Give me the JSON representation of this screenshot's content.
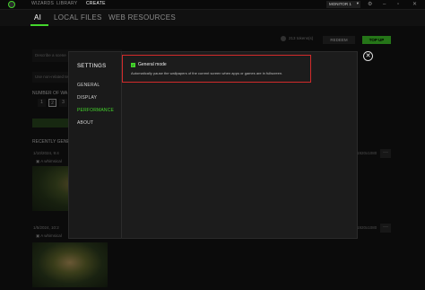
{
  "nav": {
    "items": [
      "WIZARDS",
      "LIBRARY",
      "CREATE"
    ],
    "active_index": 2
  },
  "monitor": {
    "label": "MONITOR 1"
  },
  "window_icons": [
    "gear-icon",
    "minimize-icon",
    "maximize-icon",
    "close-icon"
  ],
  "tabs": {
    "items": [
      "AI",
      "LOCAL FILES",
      "WEB RESOURCES"
    ],
    "active": "AI"
  },
  "tokens": {
    "text": "213 tokens(s)"
  },
  "buttons": {
    "redeem": "REDEEM",
    "top_up": "TOP UP"
  },
  "form": {
    "prompt_placeholder": "Describe a scene",
    "negative_placeholder": "Use non-related terms",
    "number_label": "NUMBER OF WA",
    "numbers": [
      "1",
      "2",
      "3"
    ],
    "selected_number": "2"
  },
  "recent": {
    "label": "RECENTLY GENE",
    "entries": [
      {
        "date": "1/10/2024, 9:4",
        "ref": "A whimsical",
        "size": "1920x1080"
      },
      {
        "date": "1/5/2024, 10:2",
        "ref": "A whimsical",
        "size": "1920x1080"
      }
    ]
  },
  "settings": {
    "title": "SETTINGS",
    "items": [
      "GENERAL",
      "DISPLAY",
      "PERFORMANCE",
      "ABOUT"
    ],
    "active": "PERFORMANCE",
    "general_mode": {
      "checked": true,
      "title": "General mode",
      "description": "Automatically pause the wallpapers of the current screen when apps or games are in fullscreen."
    },
    "accent": "#44d62c",
    "highlight": "#d22b2b"
  }
}
